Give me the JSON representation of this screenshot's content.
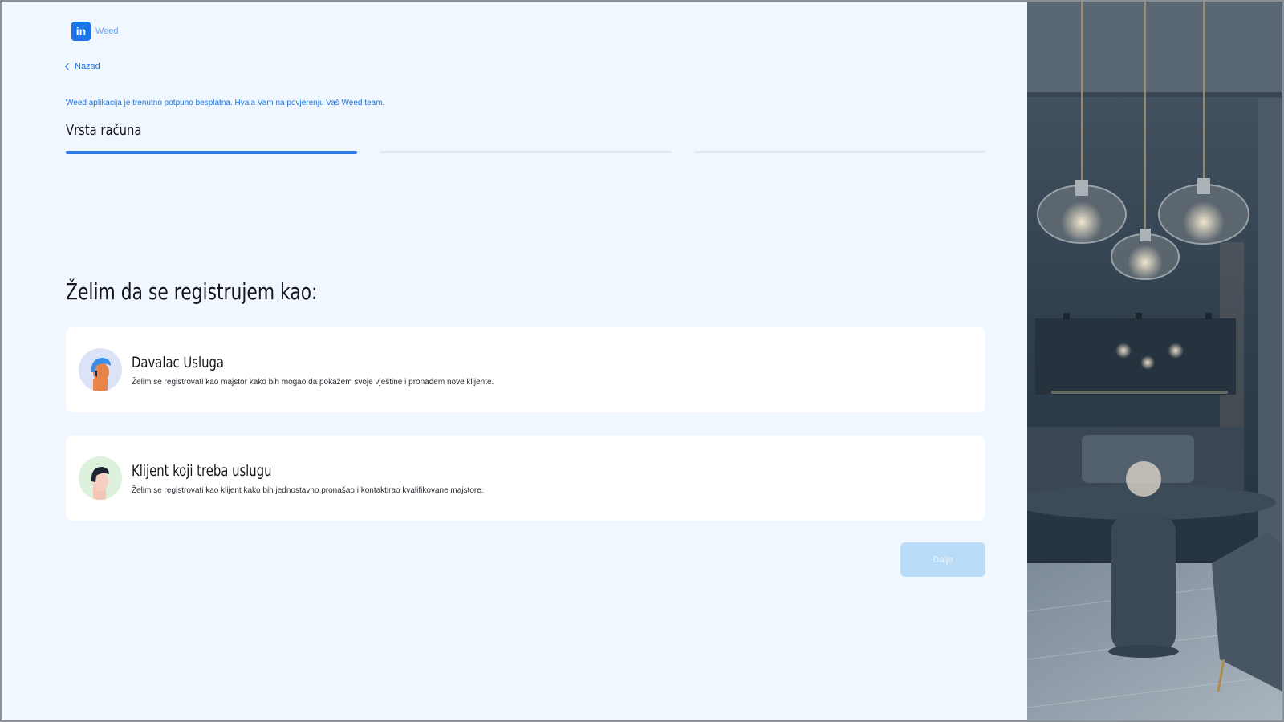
{
  "brand": {
    "logo_mark": "in",
    "name": "Weed"
  },
  "nav": {
    "back_label": "Nazad"
  },
  "notice": "Weed aplikacija je trenutno potpuno besplatna. Hvala Vam na povjerenju Vaš Weed team.",
  "stepper": {
    "current_title": "Vrsta računa",
    "total_steps": 3,
    "active_step": 1
  },
  "main": {
    "heading": "Želim da se registrujem kao:",
    "options": [
      {
        "title": "Davalac Usluga",
        "description": "Želim se registrovati kao majstor kako bih mogao da pokažem svoje vještine i pronađem nove klijente."
      },
      {
        "title": "Klijent koji treba uslugu",
        "description": "Želim se registrovati kao klijent kako bih jednostavno pronašao i kontaktirao kvalifikovane majstore."
      }
    ]
  },
  "actions": {
    "next_label": "Dalje"
  },
  "colors": {
    "accent": "#1976e8",
    "background": "#f1f7fe",
    "button_disabled": "#b9dcf8"
  }
}
